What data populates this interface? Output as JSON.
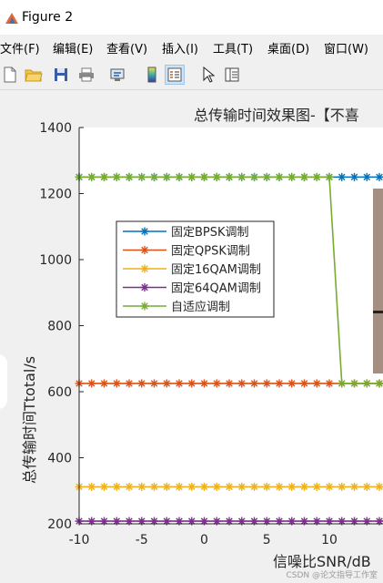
{
  "window": {
    "title": "Figure 2"
  },
  "menu": [
    "文件(F)",
    "编辑(E)",
    "查看(V)",
    "插入(I)",
    "工具(T)",
    "桌面(D)",
    "窗口(W)"
  ],
  "toolbar": [
    "new-figure-icon",
    "open-file-icon",
    "save-icon",
    "print-icon",
    "link-icon",
    "colorbar-icon",
    "legend-icon",
    "pointer-icon",
    "property-inspector-icon"
  ],
  "colors": {
    "bpsk": "#0072bd",
    "qpsk": "#d95319",
    "qam16": "#edb120",
    "qam64": "#7e2f8e",
    "adaptive": "#77ac30"
  },
  "chart_data": {
    "type": "line",
    "title": "总传输时间效果图-【不喜",
    "xlabel": "信噪比SNR/dB",
    "ylabel": "总传输时间Ttotal/s",
    "xlim": [
      -10,
      16
    ],
    "ylim": [
      200,
      1400
    ],
    "x_ticks": [
      "-10",
      "-5",
      "0",
      "5",
      "10"
    ],
    "y_ticks": [
      "200",
      "400",
      "600",
      "800",
      "1000",
      "1200",
      "1400"
    ],
    "legend_position": "inside-left",
    "series": [
      {
        "name": "固定BPSK调制",
        "x": [
          -10,
          16
        ],
        "y": [
          1250,
          1250
        ]
      },
      {
        "name": "固定QPSK调制",
        "x": [
          -10,
          16
        ],
        "y": [
          625,
          625
        ]
      },
      {
        "name": "固定16QAM调制",
        "x": [
          -10,
          16
        ],
        "y": [
          312,
          312
        ]
      },
      {
        "name": "固定64QAM调制",
        "x": [
          -10,
          16
        ],
        "y": [
          208,
          208
        ]
      },
      {
        "name": "自适应调制",
        "x": [
          -10,
          10,
          11,
          16
        ],
        "y": [
          1250,
          1250,
          625,
          625
        ]
      }
    ]
  },
  "watermark": "CSDN @论文指导工作室"
}
